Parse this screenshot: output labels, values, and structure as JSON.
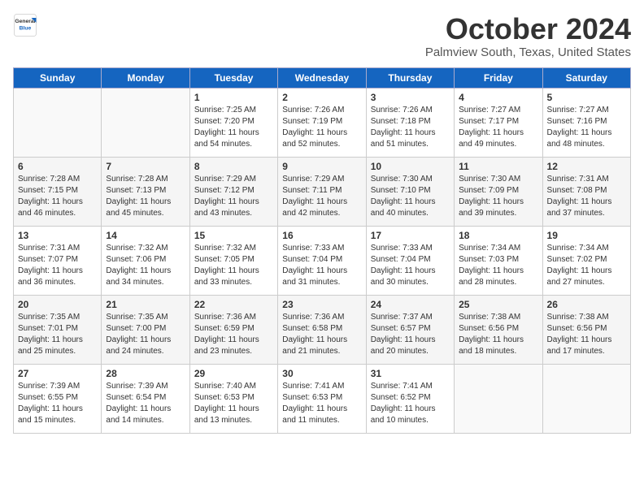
{
  "header": {
    "logo_general": "General",
    "logo_blue": "Blue",
    "title": "October 2024",
    "location": "Palmview South, Texas, United States"
  },
  "days_of_week": [
    "Sunday",
    "Monday",
    "Tuesday",
    "Wednesday",
    "Thursday",
    "Friday",
    "Saturday"
  ],
  "weeks": [
    [
      {
        "day": "",
        "data": ""
      },
      {
        "day": "",
        "data": ""
      },
      {
        "day": "1",
        "data": "Sunrise: 7:25 AM\nSunset: 7:20 PM\nDaylight: 11 hours and 54 minutes."
      },
      {
        "day": "2",
        "data": "Sunrise: 7:26 AM\nSunset: 7:19 PM\nDaylight: 11 hours and 52 minutes."
      },
      {
        "day": "3",
        "data": "Sunrise: 7:26 AM\nSunset: 7:18 PM\nDaylight: 11 hours and 51 minutes."
      },
      {
        "day": "4",
        "data": "Sunrise: 7:27 AM\nSunset: 7:17 PM\nDaylight: 11 hours and 49 minutes."
      },
      {
        "day": "5",
        "data": "Sunrise: 7:27 AM\nSunset: 7:16 PM\nDaylight: 11 hours and 48 minutes."
      }
    ],
    [
      {
        "day": "6",
        "data": "Sunrise: 7:28 AM\nSunset: 7:15 PM\nDaylight: 11 hours and 46 minutes."
      },
      {
        "day": "7",
        "data": "Sunrise: 7:28 AM\nSunset: 7:13 PM\nDaylight: 11 hours and 45 minutes."
      },
      {
        "day": "8",
        "data": "Sunrise: 7:29 AM\nSunset: 7:12 PM\nDaylight: 11 hours and 43 minutes."
      },
      {
        "day": "9",
        "data": "Sunrise: 7:29 AM\nSunset: 7:11 PM\nDaylight: 11 hours and 42 minutes."
      },
      {
        "day": "10",
        "data": "Sunrise: 7:30 AM\nSunset: 7:10 PM\nDaylight: 11 hours and 40 minutes."
      },
      {
        "day": "11",
        "data": "Sunrise: 7:30 AM\nSunset: 7:09 PM\nDaylight: 11 hours and 39 minutes."
      },
      {
        "day": "12",
        "data": "Sunrise: 7:31 AM\nSunset: 7:08 PM\nDaylight: 11 hours and 37 minutes."
      }
    ],
    [
      {
        "day": "13",
        "data": "Sunrise: 7:31 AM\nSunset: 7:07 PM\nDaylight: 11 hours and 36 minutes."
      },
      {
        "day": "14",
        "data": "Sunrise: 7:32 AM\nSunset: 7:06 PM\nDaylight: 11 hours and 34 minutes."
      },
      {
        "day": "15",
        "data": "Sunrise: 7:32 AM\nSunset: 7:05 PM\nDaylight: 11 hours and 33 minutes."
      },
      {
        "day": "16",
        "data": "Sunrise: 7:33 AM\nSunset: 7:04 PM\nDaylight: 11 hours and 31 minutes."
      },
      {
        "day": "17",
        "data": "Sunrise: 7:33 AM\nSunset: 7:04 PM\nDaylight: 11 hours and 30 minutes."
      },
      {
        "day": "18",
        "data": "Sunrise: 7:34 AM\nSunset: 7:03 PM\nDaylight: 11 hours and 28 minutes."
      },
      {
        "day": "19",
        "data": "Sunrise: 7:34 AM\nSunset: 7:02 PM\nDaylight: 11 hours and 27 minutes."
      }
    ],
    [
      {
        "day": "20",
        "data": "Sunrise: 7:35 AM\nSunset: 7:01 PM\nDaylight: 11 hours and 25 minutes."
      },
      {
        "day": "21",
        "data": "Sunrise: 7:35 AM\nSunset: 7:00 PM\nDaylight: 11 hours and 24 minutes."
      },
      {
        "day": "22",
        "data": "Sunrise: 7:36 AM\nSunset: 6:59 PM\nDaylight: 11 hours and 23 minutes."
      },
      {
        "day": "23",
        "data": "Sunrise: 7:36 AM\nSunset: 6:58 PM\nDaylight: 11 hours and 21 minutes."
      },
      {
        "day": "24",
        "data": "Sunrise: 7:37 AM\nSunset: 6:57 PM\nDaylight: 11 hours and 20 minutes."
      },
      {
        "day": "25",
        "data": "Sunrise: 7:38 AM\nSunset: 6:56 PM\nDaylight: 11 hours and 18 minutes."
      },
      {
        "day": "26",
        "data": "Sunrise: 7:38 AM\nSunset: 6:56 PM\nDaylight: 11 hours and 17 minutes."
      }
    ],
    [
      {
        "day": "27",
        "data": "Sunrise: 7:39 AM\nSunset: 6:55 PM\nDaylight: 11 hours and 15 minutes."
      },
      {
        "day": "28",
        "data": "Sunrise: 7:39 AM\nSunset: 6:54 PM\nDaylight: 11 hours and 14 minutes."
      },
      {
        "day": "29",
        "data": "Sunrise: 7:40 AM\nSunset: 6:53 PM\nDaylight: 11 hours and 13 minutes."
      },
      {
        "day": "30",
        "data": "Sunrise: 7:41 AM\nSunset: 6:53 PM\nDaylight: 11 hours and 11 minutes."
      },
      {
        "day": "31",
        "data": "Sunrise: 7:41 AM\nSunset: 6:52 PM\nDaylight: 11 hours and 10 minutes."
      },
      {
        "day": "",
        "data": ""
      },
      {
        "day": "",
        "data": ""
      }
    ]
  ]
}
